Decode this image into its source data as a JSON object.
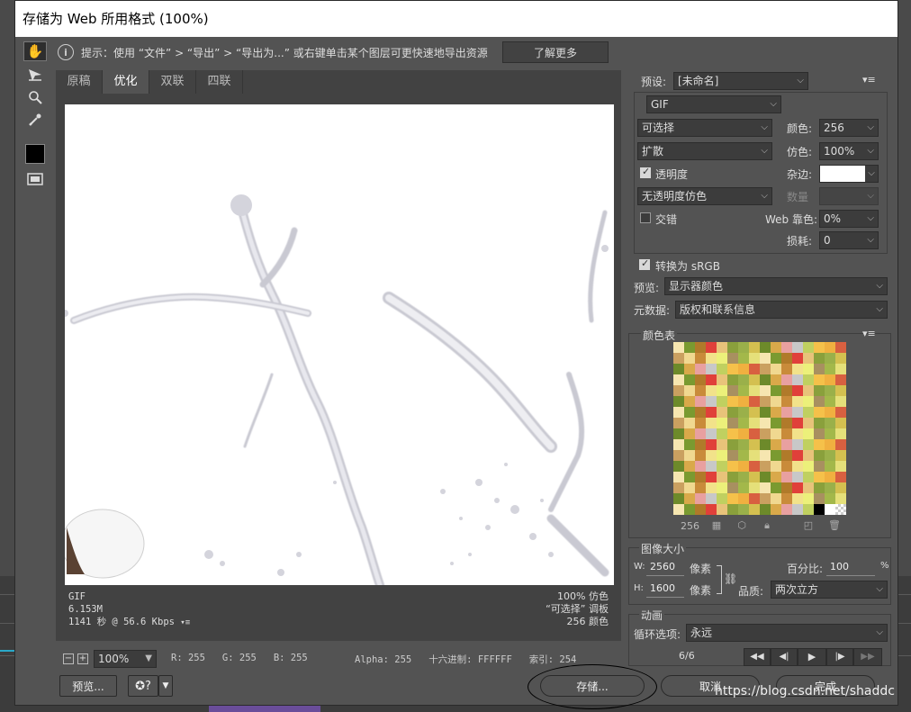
{
  "window": {
    "title": "存储为 Web 所用格式 (100%)"
  },
  "hint": {
    "text": "提示：使用 “文件” > “导出” > “导出为...” 或右键单击某个图层可更快速地导出资源",
    "learn_more": "了解更多"
  },
  "tabs": [
    "原稿",
    "优化",
    "双联",
    "四联"
  ],
  "active_tab": "优化",
  "image_info": {
    "format": "GIF",
    "size": "6.153M",
    "time": "1141 秒 @ 56.6 Kbps",
    "dither": "100% 仿色",
    "palette": "“可选择” 调板",
    "colors": "256 颜色"
  },
  "status": {
    "zoom": "100%",
    "r": "R: 255",
    "g": "G: 255",
    "b": "B: 255",
    "alpha": "Alpha: 255",
    "hex": "十六进制: FFFFFF",
    "index": "索引: 254"
  },
  "buttons": {
    "preview": "预览...",
    "save": "存储...",
    "cancel": "取消",
    "done": "完成"
  },
  "settings": {
    "preset_label": "预设:",
    "preset_value": "[未命名]",
    "format": "GIF",
    "reduction": "可选择",
    "dither_algo": "扩散",
    "transparency_label": "透明度",
    "transparency_dither": "无透明度仿色",
    "interlaced_label": "交错",
    "colors_label": "颜色:",
    "colors_value": "256",
    "dither_label": "仿色:",
    "dither_value": "100%",
    "matte_label": "杂边:",
    "amount_label": "数量",
    "web_snap_label": "Web 靠色:",
    "web_snap_value": "0%",
    "lossy_label": "损耗:",
    "lossy_value": "0",
    "convert_srgb_label": "转换为 sRGB",
    "preview_label": "预览:",
    "preview_value": "显示器颜色",
    "metadata_label": "元数据:",
    "metadata_value": "版权和联系信息"
  },
  "color_table": {
    "title": "颜色表",
    "count": "256"
  },
  "image_size": {
    "title": "图像大小",
    "w_label": "W:",
    "w_value": "2560",
    "w_unit": "像素",
    "h_label": "H:",
    "h_value": "1600",
    "h_unit": "像素",
    "percent_label": "百分比:",
    "percent_value": "100",
    "percent_unit": "%",
    "quality_label": "品质:",
    "quality_value": "两次立方"
  },
  "animation": {
    "title": "动画",
    "loop_label": "循环选项:",
    "loop_value": "永远",
    "frame": "6/6"
  },
  "watermark": "https://blog.csdn.net/shaddc"
}
